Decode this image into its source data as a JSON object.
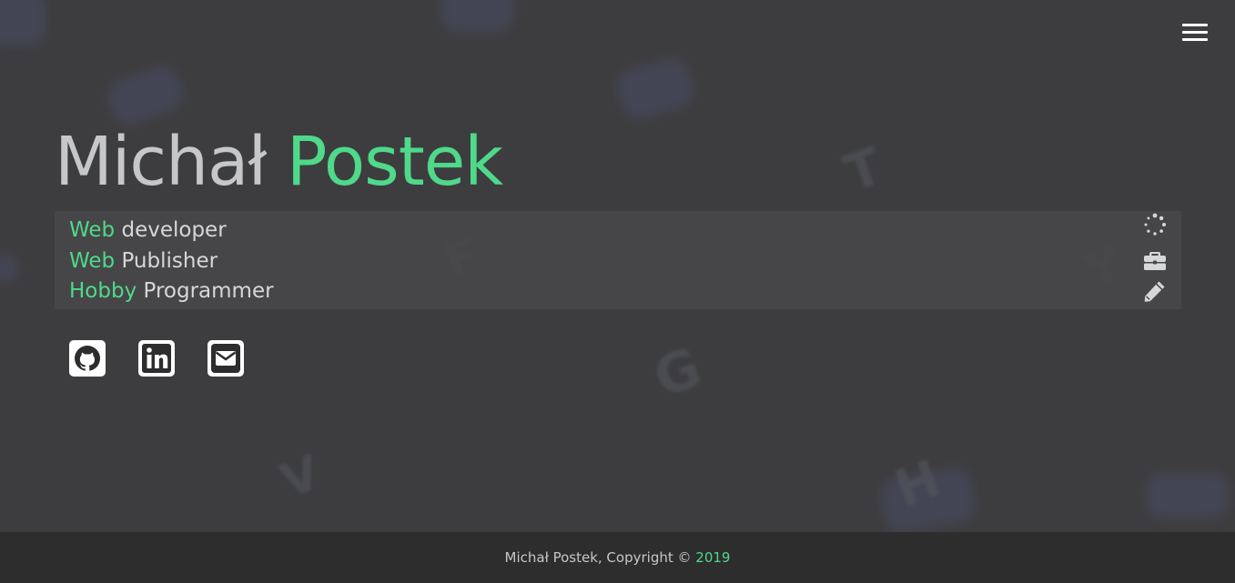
{
  "header": {
    "menu_icon": "hamburger-menu-icon"
  },
  "hero": {
    "first_name": "Michał",
    "last_name": "Postek"
  },
  "roles": [
    {
      "accent": "Web",
      "rest": "developer",
      "icon": "spinner-icon"
    },
    {
      "accent": "Web",
      "rest": "Publisher",
      "icon": "briefcase-icon"
    },
    {
      "accent": "Hobby",
      "rest": "Programmer",
      "icon": "pencil-icon"
    }
  ],
  "socials": [
    {
      "name": "GitHub",
      "icon": "github-icon"
    },
    {
      "name": "LinkedIn",
      "icon": "linkedin-icon"
    },
    {
      "name": "Email",
      "icon": "envelope-icon"
    }
  ],
  "footer": {
    "text": "Michał Postek, Copyright © ",
    "year": "2019"
  },
  "colors": {
    "accent": "#4fd98a",
    "background": "#3d3d3f",
    "footer_background": "#2d2d2e",
    "text": "#c5c7c9"
  }
}
